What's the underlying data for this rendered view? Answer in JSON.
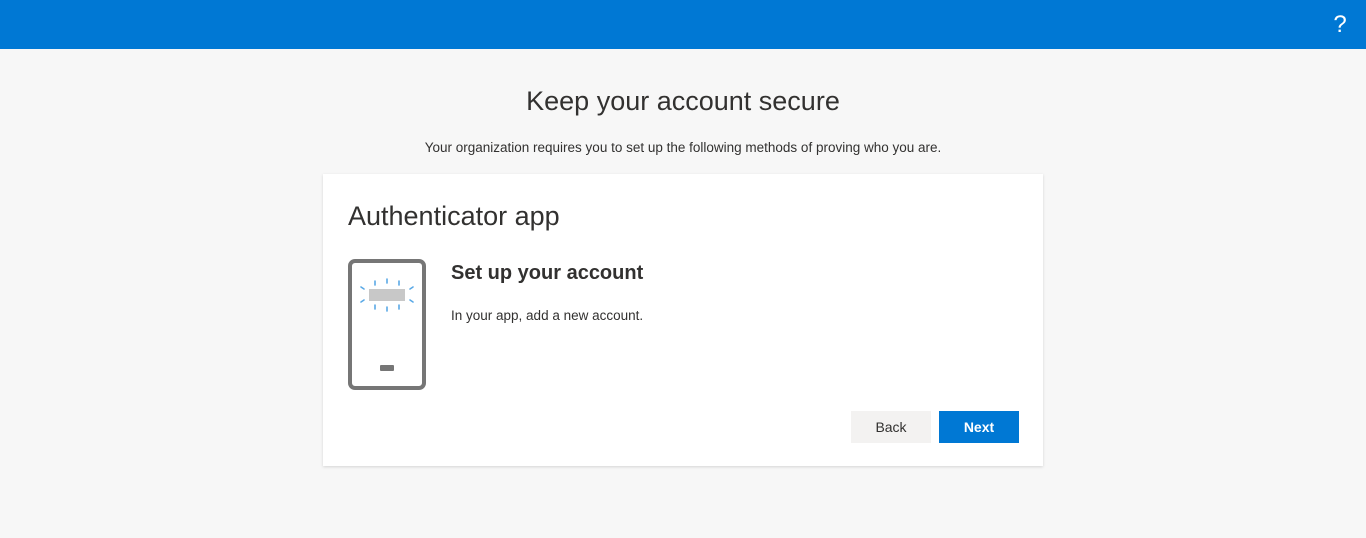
{
  "header": {
    "help_label": "?"
  },
  "page": {
    "title": "Keep your account secure",
    "subtitle": "Your organization requires you to set up the following methods of proving who you are."
  },
  "card": {
    "title": "Authenticator app",
    "step_title": "Set up your account",
    "step_description": "In your app, add a new account.",
    "back_label": "Back",
    "next_label": "Next"
  },
  "colors": {
    "brand_blue": "#0078d4",
    "background": "#f7f7f7"
  },
  "icons": {
    "help": "question-mark-icon",
    "phone": "phone-illustration-icon"
  }
}
